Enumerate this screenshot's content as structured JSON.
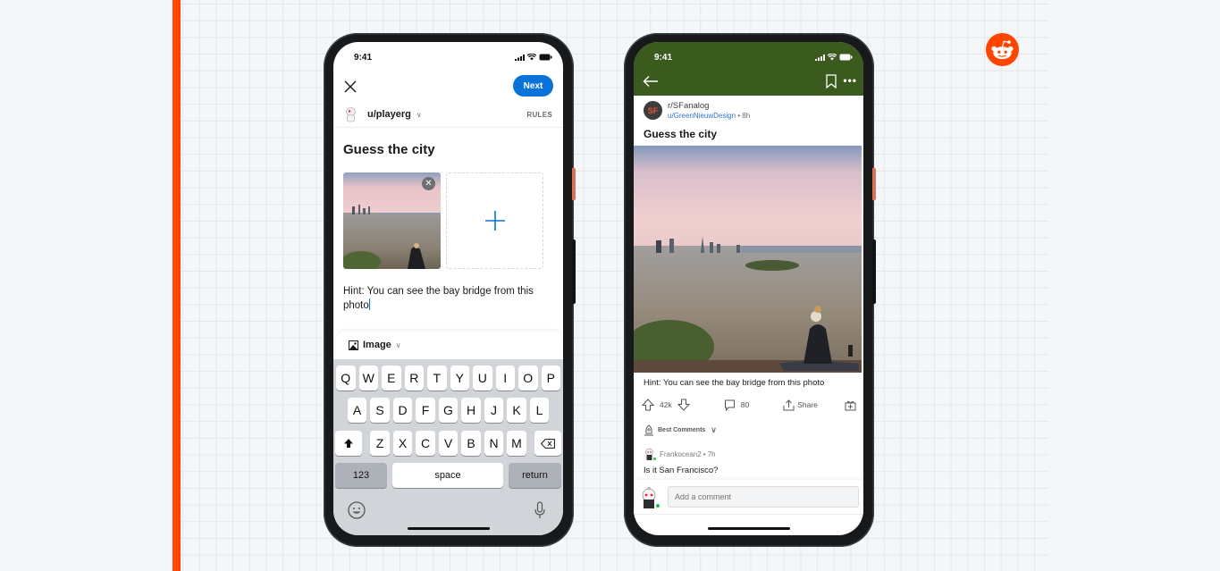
{
  "colors": {
    "brand": "#ff4500",
    "primary_button": "#0a73d9",
    "subreddit_header": "#3b5a1d",
    "keyboard_bg": "#d1d4d9",
    "link": "#2b74c6",
    "online": "#2bbd5c"
  },
  "brand_logo": {
    "icon": "reddit-snoo-icon"
  },
  "composer_phone": {
    "status_time": "9:41",
    "close_icon": "close-icon",
    "next_label": "Next",
    "user": "u/playerg",
    "rules_label": "RULES",
    "post_title": "Guess the city",
    "attached_image_alt": "San Francisco skyline from hilltop",
    "add_media_icon": "plus-icon",
    "body_text": "Hint: You can see the bay bridge from this photo",
    "post_type_label": "Image",
    "keyboard": {
      "row1": [
        "Q",
        "W",
        "E",
        "R",
        "T",
        "Y",
        "U",
        "I",
        "O",
        "P"
      ],
      "row2": [
        "A",
        "S",
        "D",
        "F",
        "G",
        "H",
        "J",
        "K",
        "L"
      ],
      "row3": [
        "Z",
        "X",
        "C",
        "V",
        "B",
        "N",
        "M"
      ],
      "numbers_label": "123",
      "space_label": "space",
      "return_label": "return"
    }
  },
  "post_phone": {
    "status_time": "9:41",
    "subreddit": "r/SFanalog",
    "subreddit_avatar_text": "SF",
    "author": "u/GreenNieuwDesign",
    "age": "• 8h",
    "post_title": "Guess the city",
    "body_text": "Hint: You can see the bay bridge from this photo",
    "votes": "42k",
    "comments_count": "80",
    "share_label": "Share",
    "sort_label": "Best Comments",
    "comment": {
      "author": "Frankocean2",
      "age": "• 7h",
      "text": "Is it San Francisco?"
    },
    "comment_placeholder": "Add a comment"
  }
}
